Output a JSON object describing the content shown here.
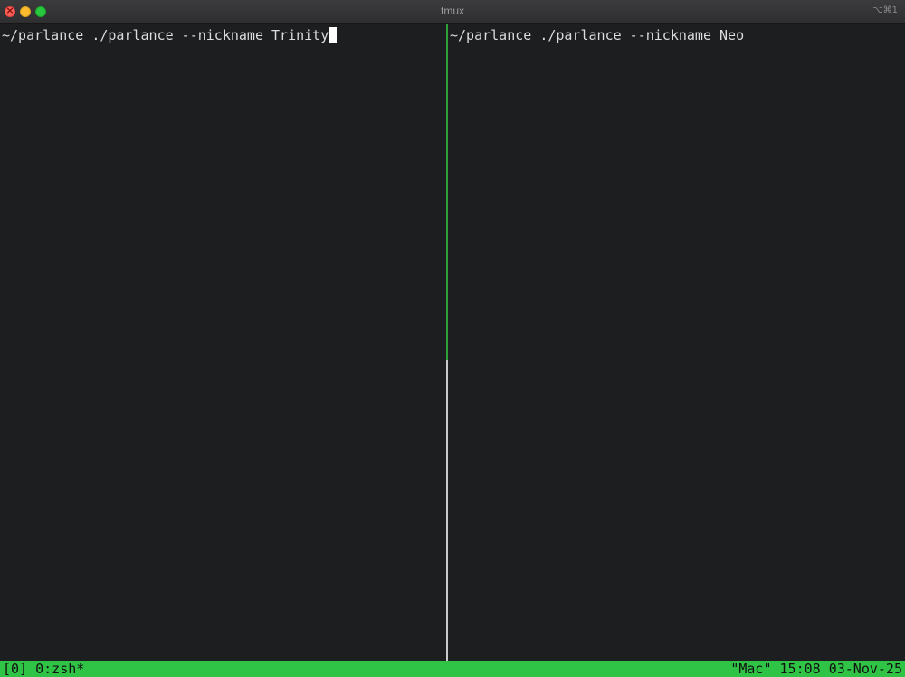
{
  "window": {
    "title": "tmux",
    "shortcut": "⌥⌘1"
  },
  "panes": {
    "left": {
      "prompt": "~/parlance ./parlance --nickname Trinity",
      "active": true
    },
    "right": {
      "prompt": "~/parlance ./parlance --nickname Neo"
    }
  },
  "status": {
    "session": "[0]",
    "window": "0:zsh*",
    "host": "\"Mac\"",
    "time": "15:08",
    "date": "03-Nov-25"
  },
  "colors": {
    "status_bar": "#2fc445",
    "active_divider": "#2f9e39",
    "pane_background": "#1c1e20"
  }
}
